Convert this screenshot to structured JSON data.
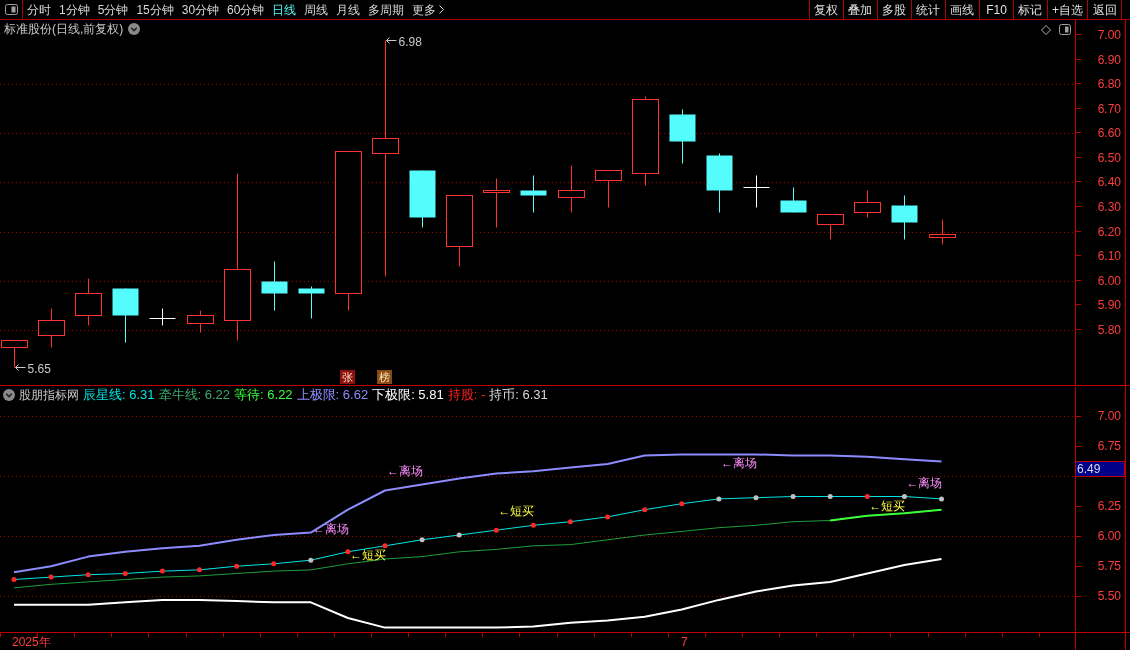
{
  "toolbar": {
    "tabs": [
      {
        "label": "分时",
        "selected": false,
        "kind": "period"
      },
      {
        "label": "1分钟",
        "selected": false,
        "kind": "period"
      },
      {
        "label": "5分钟",
        "selected": false,
        "kind": "period"
      },
      {
        "label": "15分钟",
        "selected": false,
        "kind": "period"
      },
      {
        "label": "30分钟",
        "selected": false,
        "kind": "period"
      },
      {
        "label": "60分钟",
        "selected": false,
        "kind": "period"
      },
      {
        "label": "日线",
        "selected": true,
        "kind": "period"
      },
      {
        "label": "周线",
        "selected": false,
        "kind": "period"
      },
      {
        "label": "月线",
        "selected": false,
        "kind": "period"
      },
      {
        "label": "多周期",
        "selected": false,
        "kind": "period"
      },
      {
        "label": "更多",
        "selected": false,
        "kind": "menu"
      }
    ],
    "buttons": [
      "复权",
      "叠加",
      "多股",
      "统计",
      "画线",
      "F10",
      "标记",
      "+自选",
      "返回"
    ]
  },
  "price_chart": {
    "title": "标准股份(日线,前复权)",
    "high_label": "6.98",
    "low_label": "5.65",
    "badges": [
      {
        "text": "张",
        "color": "#8c1010"
      },
      {
        "text": "榜",
        "color": "#8a4a14"
      }
    ],
    "axis_labels": [
      "7.00",
      "6.90",
      "6.80",
      "6.70",
      "6.60",
      "6.50",
      "6.40",
      "6.30",
      "6.20",
      "6.10",
      "6.00",
      "5.90",
      "5.80"
    ]
  },
  "indicator": {
    "legend": {
      "title": "股朋指标网",
      "items": [
        {
          "text": "辰星线: 6.31",
          "color": "#00e6e6"
        },
        {
          "text": "牵牛线: 6.22",
          "color": "#3aa868"
        },
        {
          "text": "等待: 6.22",
          "color": "#3cff3c"
        },
        {
          "text": "上极限: 6.62",
          "color": "#8c8cff"
        },
        {
          "text": "下极限: 5.81",
          "color": "#ffffff"
        },
        {
          "text": "持股: -",
          "color": "#ff2020"
        },
        {
          "text": "持币: 6.31",
          "color": "#d8d8d8"
        }
      ]
    },
    "cursor_value": "6.49",
    "chart_data": {
      "type": "line",
      "categories": [
        null,
        null,
        null,
        null,
        null,
        null,
        null,
        null,
        null,
        null,
        null,
        null,
        null,
        null,
        null,
        null,
        null,
        null,
        null,
        null,
        null,
        null,
        null,
        null,
        null,
        null
      ],
      "grid": true,
      "ylim": [
        5.22,
        7.24
      ],
      "yticks": [
        {
          "value": 7,
          "label": "7.00"
        },
        {
          "value": 6.75,
          "label": "6.75"
        },
        {
          "value": 6.25,
          "label": "6.25"
        },
        {
          "value": 6,
          "label": "6.00"
        },
        {
          "value": 5.75,
          "label": "5.75"
        },
        {
          "value": 5.5,
          "label": "5.50"
        }
      ],
      "series": [
        {
          "color": "#8c8cff",
          "values": [
            5.7,
            5.75,
            5.83,
            5.87,
            5.9,
            5.92,
            5.97,
            6.01,
            6.03,
            6.22,
            6.38,
            6.43,
            6.48,
            6.52,
            6.54,
            6.57,
            6.6,
            6.67,
            6.68,
            6.68,
            6.68,
            6.67,
            6.67,
            6.66,
            6.64,
            6.62
          ]
        },
        {
          "color": "#00e6e6",
          "values": [
            5.64,
            5.66,
            5.68,
            5.69,
            5.71,
            5.72,
            5.75,
            5.77,
            5.8,
            5.87,
            5.92,
            5.97,
            6.01,
            6.05,
            6.09,
            6.12,
            6.16,
            6.22,
            6.27,
            6.31,
            6.32,
            6.33,
            6.33,
            6.33,
            6.33,
            6.31
          ]
        },
        {
          "color": "#1e9e3c",
          "values": [
            5.57,
            5.6,
            5.62,
            5.64,
            5.66,
            5.67,
            5.69,
            5.71,
            5.72,
            5.77,
            5.81,
            5.83,
            5.87,
            5.89,
            5.92,
            5.93,
            5.97,
            6.01,
            6.04,
            6.07,
            6.09,
            6.12,
            6.13,
            6.17,
            6.19,
            6.22
          ]
        },
        {
          "color": "#3cff3c",
          "values": [
            null,
            null,
            null,
            null,
            null,
            null,
            null,
            null,
            null,
            null,
            null,
            null,
            null,
            null,
            null,
            null,
            null,
            null,
            null,
            null,
            null,
            null,
            6.13,
            6.17,
            6.19,
            6.22
          ]
        },
        {
          "color": "#ffffff",
          "values": [
            5.43,
            5.43,
            5.43,
            5.45,
            5.47,
            5.47,
            5.46,
            5.45,
            5.45,
            5.32,
            5.24,
            5.24,
            5.24,
            5.24,
            5.25,
            5.28,
            5.3,
            5.33,
            5.39,
            5.47,
            5.54,
            5.59,
            5.62,
            5.69,
            5.76,
            5.81
          ]
        }
      ]
    },
    "signal_labels": [
      {
        "text": "←离场",
        "kind": "exit"
      },
      {
        "text": "←短买",
        "kind": "buy"
      },
      {
        "text": "←离场",
        "kind": "exit"
      },
      {
        "text": "←短买",
        "kind": "buy"
      },
      {
        "text": "←离场",
        "kind": "exit"
      },
      {
        "text": "←短买",
        "kind": "buy"
      },
      {
        "text": "←离场",
        "kind": "exit"
      }
    ],
    "signal_dots": [
      {
        "color": "#ff2828"
      },
      {
        "color": "#ff2828"
      },
      {
        "color": "#ff2828"
      },
      {
        "color": "#ff2828"
      },
      {
        "color": "#ff2828"
      },
      {
        "color": "#ff2828"
      },
      {
        "color": "#ff2828"
      },
      {
        "color": "#ff2828"
      },
      {
        "color": "#c0c0c0"
      },
      {
        "color": "#ff2828"
      },
      {
        "color": "#ff2828"
      },
      {
        "color": "#c0c0c0"
      },
      {
        "color": "#c0c0c0"
      },
      {
        "color": "#ff2828"
      },
      {
        "color": "#ff2828"
      },
      {
        "color": "#ff2828"
      },
      {
        "color": "#ff2828"
      },
      {
        "color": "#ff2828"
      },
      {
        "color": "#ff2828"
      },
      {
        "color": "#c0c0c0"
      },
      {
        "color": "#c0c0c0"
      },
      {
        "color": "#c0c0c0"
      },
      {
        "color": "#c0c0c0"
      },
      {
        "color": "#ff2828"
      },
      {
        "color": "#c0c0c0"
      },
      {
        "color": "#c0c0c0"
      }
    ]
  },
  "date_axis": [
    "2025年",
    "7"
  ]
}
